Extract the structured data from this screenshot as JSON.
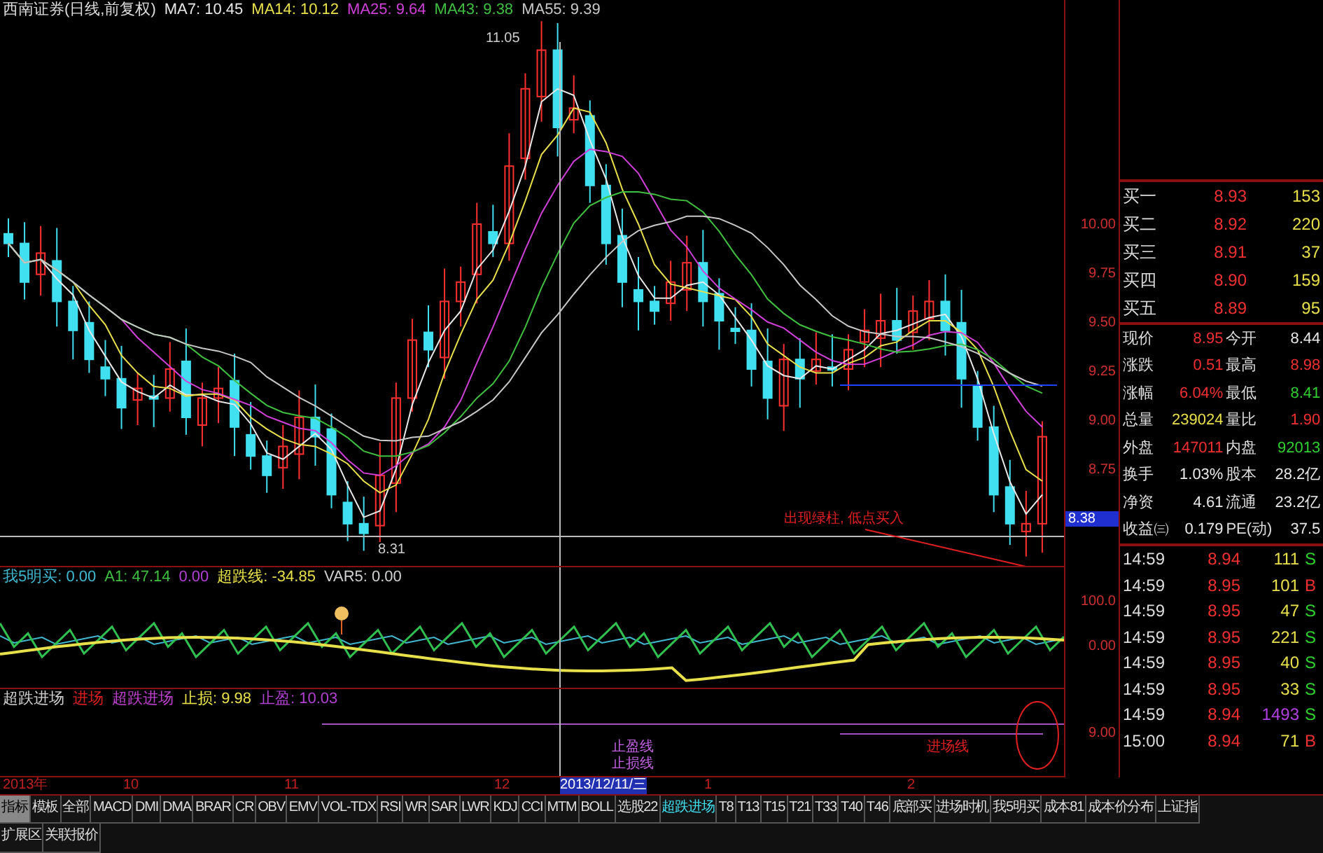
{
  "chart_header": {
    "title": "西南证券(日线,前复权)",
    "mas": [
      {
        "label": "MA7: 10.45",
        "color": "#e8e8e8"
      },
      {
        "label": "MA14: 10.12",
        "color": "#e8e04a"
      },
      {
        "label": "MA25: 9.64",
        "color": "#d040d8"
      },
      {
        "label": "MA43: 9.38",
        "color": "#40c040"
      },
      {
        "label": "MA55: 9.39",
        "color": "#c8c8c8"
      }
    ]
  },
  "price_annotations": {
    "high": "11.05",
    "low": "8.31",
    "note": "出现绿柱, 低点买入",
    "current_price_tag": "8.38"
  },
  "price_axis": [
    "10.00",
    "9.75",
    "9.50",
    "9.25",
    "9.00",
    "8.75"
  ],
  "indicator_1": {
    "items": [
      {
        "label": "我5明买: 0.00",
        "color": "#40b8d0"
      },
      {
        "label": "A1: 47.14",
        "color": "#40c040"
      },
      {
        "label": "0.00",
        "color": "#b040d0"
      },
      {
        "label": "超跌线: -34.85",
        "color": "#e8e04a"
      },
      {
        "label": "VAR5: 0.00",
        "color": "#d0d0d0"
      }
    ],
    "axis": [
      "100.0",
      "0.00"
    ]
  },
  "indicator_2": {
    "items": [
      {
        "label": "超跌进场",
        "color": "#d0d0d0"
      },
      {
        "label": "进场",
        "color": "#e02020"
      },
      {
        "label": "超跌进场",
        "color": "#c040d0"
      },
      {
        "label": "止损: 9.98",
        "color": "#e8e04a"
      },
      {
        "label": "止盈: 10.03",
        "color": "#b040d0"
      }
    ],
    "axis": [
      "9.00"
    ],
    "line_labels": [
      "止盈线",
      "止损线"
    ],
    "entry_label": "进场线"
  },
  "date_axis": [
    {
      "label": "2013年",
      "selected": false
    },
    {
      "label": "10",
      "selected": false
    },
    {
      "label": "11",
      "selected": false
    },
    {
      "label": "12",
      "selected": false
    },
    {
      "label": "2013/12/11/三",
      "selected": true
    },
    {
      "label": "1",
      "selected": false
    },
    {
      "label": "2",
      "selected": false
    }
  ],
  "order_book": [
    {
      "label": "买一",
      "price": "8.93",
      "volume": "153"
    },
    {
      "label": "买二",
      "price": "8.92",
      "volume": "220"
    },
    {
      "label": "买三",
      "price": "8.91",
      "volume": "37"
    },
    {
      "label": "买四",
      "price": "8.90",
      "volume": "159"
    },
    {
      "label": "买五",
      "price": "8.89",
      "volume": "95"
    }
  ],
  "quote": [
    [
      {
        "label": "现价",
        "value": "8.95",
        "color": "#f03030"
      },
      {
        "label": "今开",
        "value": "8.44",
        "color": "#e8e8e8"
      }
    ],
    [
      {
        "label": "涨跌",
        "value": "0.51",
        "color": "#f03030"
      },
      {
        "label": "最高",
        "value": "8.98",
        "color": "#f03030"
      }
    ],
    [
      {
        "label": "涨幅",
        "value": "6.04%",
        "color": "#f03030"
      },
      {
        "label": "最低",
        "value": "8.41",
        "color": "#30d030"
      }
    ],
    [
      {
        "label": "总量",
        "value": "239024",
        "color": "#e8e04a"
      },
      {
        "label": "量比",
        "value": "1.90",
        "color": "#f03030"
      }
    ],
    [
      {
        "label": "外盘",
        "value": "147011",
        "color": "#f03030"
      },
      {
        "label": "内盘",
        "value": "92013",
        "color": "#30d030"
      }
    ],
    [
      {
        "label": "换手",
        "value": "1.03%",
        "color": "#e8e8e8"
      },
      {
        "label": "股本",
        "value": "28.2亿",
        "color": "#e8e8e8"
      }
    ],
    [
      {
        "label": "净资",
        "value": "4.61",
        "color": "#e8e8e8"
      },
      {
        "label": "流通",
        "value": "23.2亿",
        "color": "#e8e8e8"
      }
    ],
    [
      {
        "label": "收益㈢",
        "value": "0.179",
        "color": "#e8e8e8"
      },
      {
        "label": "PE(动)",
        "value": "37.5",
        "color": "#e8e8e8"
      }
    ]
  ],
  "trades": [
    {
      "time": "14:59",
      "price": "8.94",
      "volume": "111",
      "side": "S",
      "large": false
    },
    {
      "time": "14:59",
      "price": "8.95",
      "volume": "101",
      "side": "B",
      "large": false
    },
    {
      "time": "14:59",
      "price": "8.95",
      "volume": "47",
      "side": "S",
      "large": false
    },
    {
      "time": "14:59",
      "price": "8.95",
      "volume": "221",
      "side": "S",
      "large": false
    },
    {
      "time": "14:59",
      "price": "8.95",
      "volume": "40",
      "side": "S",
      "large": false
    },
    {
      "time": "14:59",
      "price": "8.95",
      "volume": "33",
      "side": "S",
      "large": false
    },
    {
      "time": "14:59",
      "price": "8.94",
      "volume": "1493",
      "side": "S",
      "large": true
    },
    {
      "time": "15:00",
      "price": "8.94",
      "volume": "71",
      "side": "B",
      "large": false
    }
  ],
  "mode_tabs": [
    {
      "label": "指标",
      "selected": true
    },
    {
      "label": "模板",
      "selected": false
    }
  ],
  "indicator_tabs": [
    {
      "label": "全部",
      "selected": false
    },
    {
      "label": "MACD",
      "selected": false
    },
    {
      "label": "DMI",
      "selected": false
    },
    {
      "label": "DMA",
      "selected": false
    },
    {
      "label": "BRAR",
      "selected": false
    },
    {
      "label": "CR",
      "selected": false
    },
    {
      "label": "OBV",
      "selected": false
    },
    {
      "label": "EMV",
      "selected": false
    },
    {
      "label": "VOL-TDX",
      "selected": false
    },
    {
      "label": "RSI",
      "selected": false
    },
    {
      "label": "WR",
      "selected": false
    },
    {
      "label": "SAR",
      "selected": false
    },
    {
      "label": "LWR",
      "selected": false
    },
    {
      "label": "KDJ",
      "selected": false
    },
    {
      "label": "CCI",
      "selected": false
    },
    {
      "label": "MTM",
      "selected": false
    },
    {
      "label": "BOLL",
      "selected": false
    },
    {
      "label": "选股22",
      "selected": false
    },
    {
      "label": "超跌进场",
      "selected": true
    },
    {
      "label": "T8",
      "selected": false
    },
    {
      "label": "T13",
      "selected": false
    },
    {
      "label": "T15",
      "selected": false
    },
    {
      "label": "T21",
      "selected": false
    },
    {
      "label": "T33",
      "selected": false
    },
    {
      "label": "T40",
      "selected": false
    },
    {
      "label": "T46",
      "selected": false
    },
    {
      "label": "底部买",
      "selected": false
    },
    {
      "label": "进场时机",
      "selected": false
    },
    {
      "label": "我5明买",
      "selected": false
    },
    {
      "label": "成本81",
      "selected": false
    },
    {
      "label": "成本价分布",
      "selected": false
    },
    {
      "label": "上证指",
      "selected": false
    }
  ],
  "bottom_tabs": [
    {
      "label": "扩展区"
    },
    {
      "label": "关联报价"
    }
  ]
}
